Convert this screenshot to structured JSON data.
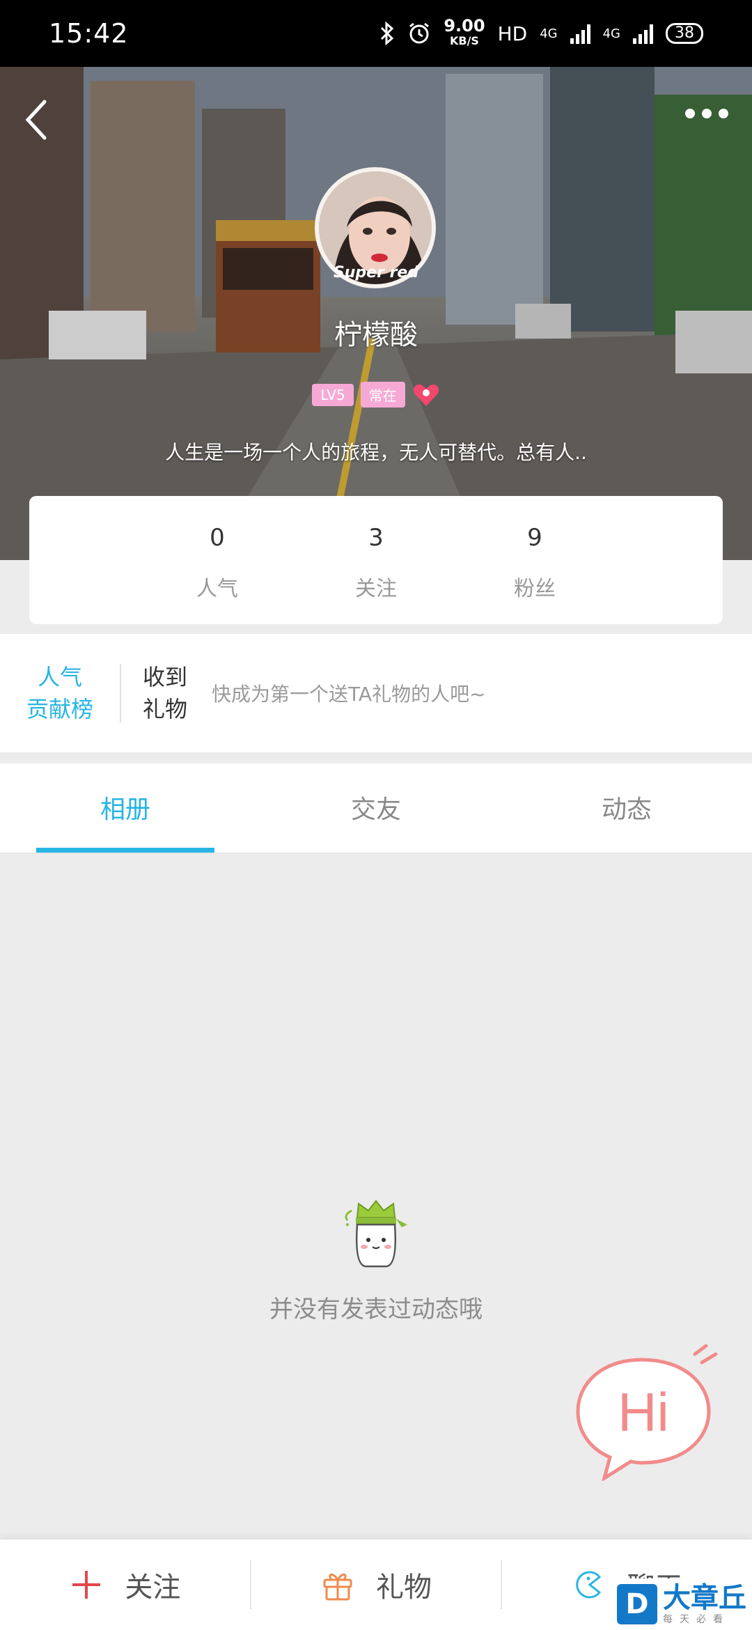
{
  "status": {
    "time": "15:42",
    "speed_value": "9.00",
    "speed_unit": "KB/S",
    "hd": "HD",
    "net1": "4G",
    "net2": "4G",
    "battery": "38"
  },
  "profile": {
    "avatar_caption": "Super red",
    "nickname": "柠檬酸",
    "level_badge": "LV5",
    "status_badge": "常在",
    "bio": "人生是一场一个人的旅程，无人可替代。总有人.."
  },
  "stats": [
    {
      "value": "0",
      "label": "人气"
    },
    {
      "value": "3",
      "label": "关注"
    },
    {
      "value": "9",
      "label": "粉丝"
    }
  ],
  "gifts": {
    "rank_line1": "人气",
    "rank_line2": "贡献榜",
    "received_line1": "收到",
    "received_line2": "礼物",
    "tip": "快成为第一个送TA礼物的人吧~"
  },
  "tabs": [
    {
      "label": "相册",
      "active": true
    },
    {
      "label": "交友",
      "active": false
    },
    {
      "label": "动态",
      "active": false
    }
  ],
  "empty_state": {
    "text": "并没有发表过动态哦"
  },
  "hi_bubble": {
    "text": "Hi"
  },
  "bottom_bar": {
    "follow": "关注",
    "gift": "礼物",
    "chat": "聊天"
  },
  "watermark": {
    "logo": "D",
    "title": "大章丘",
    "subtitle": "每天必看"
  },
  "colors": {
    "accent": "#27b5e3",
    "badge_pink": "#f7a9d6",
    "hi_bubble": "#f28b8b",
    "follow_plus": "#e2474a",
    "gift_orange": "#f08a4b"
  }
}
